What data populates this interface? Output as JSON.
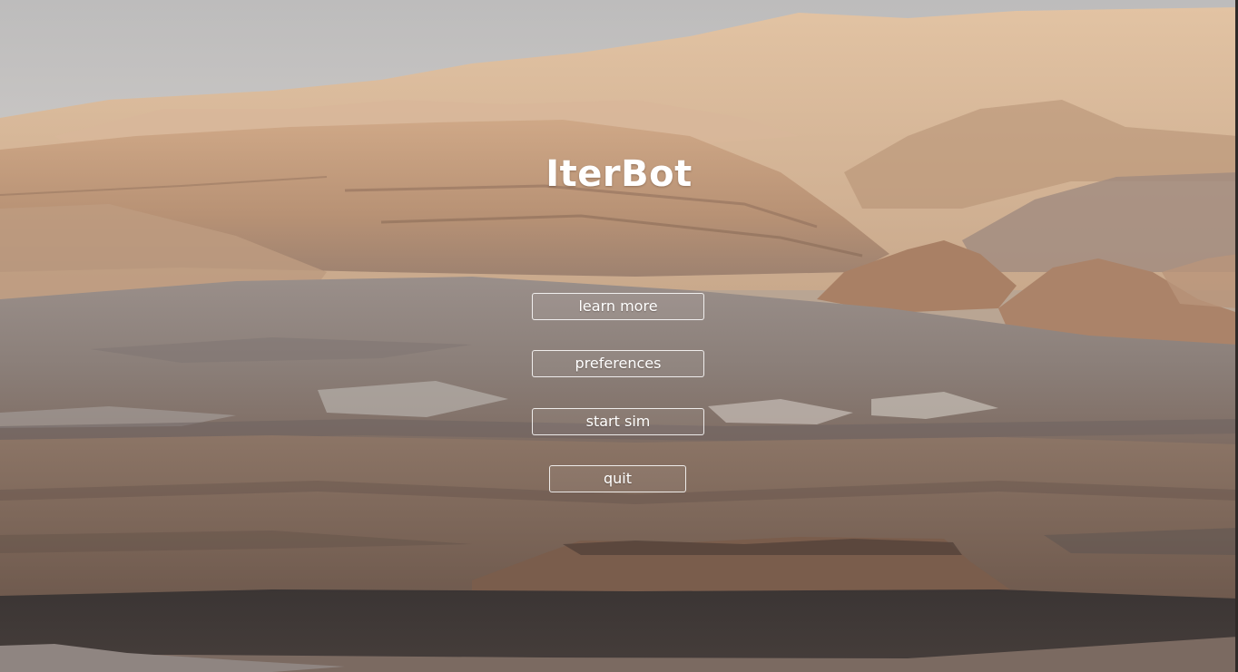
{
  "app": {
    "title": "IterBot"
  },
  "menu": {
    "learn_more": "learn more",
    "preferences": "preferences",
    "start_sim": "start sim",
    "quit": "quit"
  },
  "colors": {
    "sky": "#c4c3c3",
    "terrain_light": "#d7b593",
    "terrain_mid": "#a98c78",
    "terrain_gray": "#8f8683",
    "dune_dark": "#3a3534",
    "button_border": "#ffffff",
    "title_text": "#ffffff"
  }
}
